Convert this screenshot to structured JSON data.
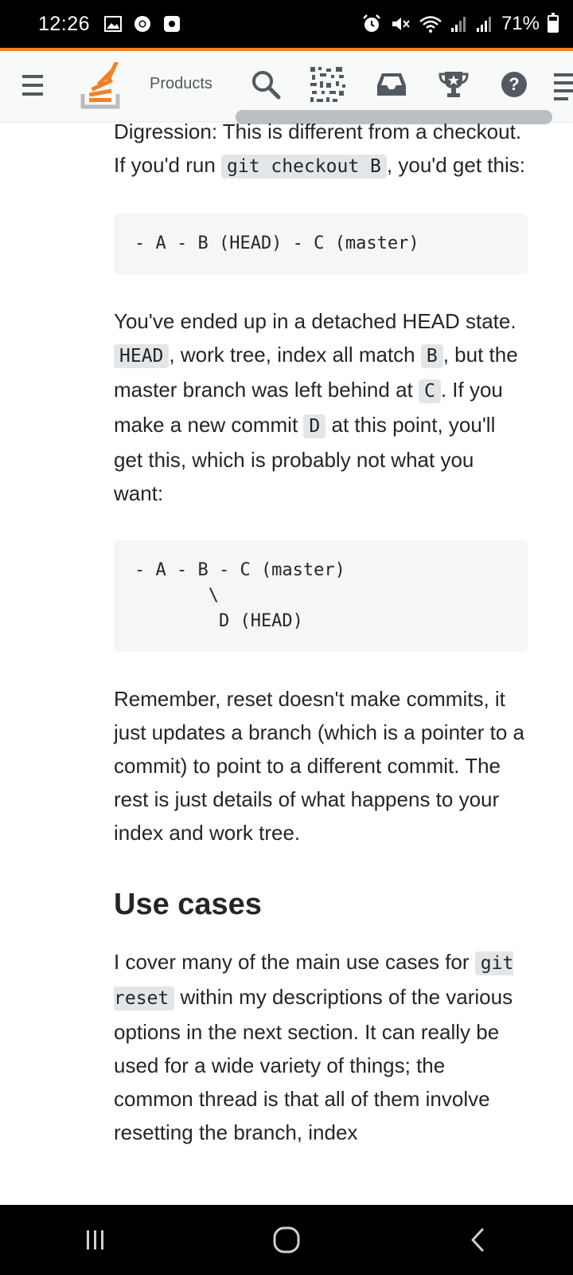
{
  "status_bar": {
    "time": "12:26",
    "battery_percent": "71%",
    "battery_level": 0.71,
    "icons_left": [
      "gallery-icon",
      "chrome-icon",
      "screen-record-icon"
    ],
    "icons_right": [
      "alarm-icon",
      "mute-icon",
      "wifi-icon",
      "signal-icon",
      "signal-icon-2"
    ]
  },
  "topbar": {
    "products_label": "Products",
    "accent_color": "#f48024"
  },
  "content": {
    "p1_before": "Digression: This is different from a checkout. If you'd run ",
    "p1_code": "git checkout B",
    "p1_after": ", you'd get this:",
    "code_block_1": "- A - B (HEAD) - C (master)",
    "p2_part1": "You've ended up in a detached HEAD state. ",
    "p2_code1": "HEAD",
    "p2_part2": ", work tree, index all match ",
    "p2_code2": "B",
    "p2_part3": ", but the master branch was left behind at ",
    "p2_code3": "C",
    "p2_part4": ". If you make a new commit ",
    "p2_code4": "D",
    "p2_part5": " at this point, you'll get this, which is probably not what you want:",
    "code_block_2": "- A - B - C (master)\n       \\\n        D (HEAD)",
    "p3": "Remember, reset doesn't make commits, it just updates a branch (which is a pointer to a commit) to point to a different commit. The rest is just details of what happens to your index and work tree.",
    "heading": "Use cases",
    "p4_part1": "I cover many of the main use cases for ",
    "p4_code": "git reset",
    "p4_part2": " within my descriptions of the various options in the next section. It can really be used for a wide variety of things; the common thread is that all of them involve resetting the branch, index"
  },
  "nav_bar": {
    "buttons": [
      "recent-apps",
      "home",
      "back"
    ]
  }
}
